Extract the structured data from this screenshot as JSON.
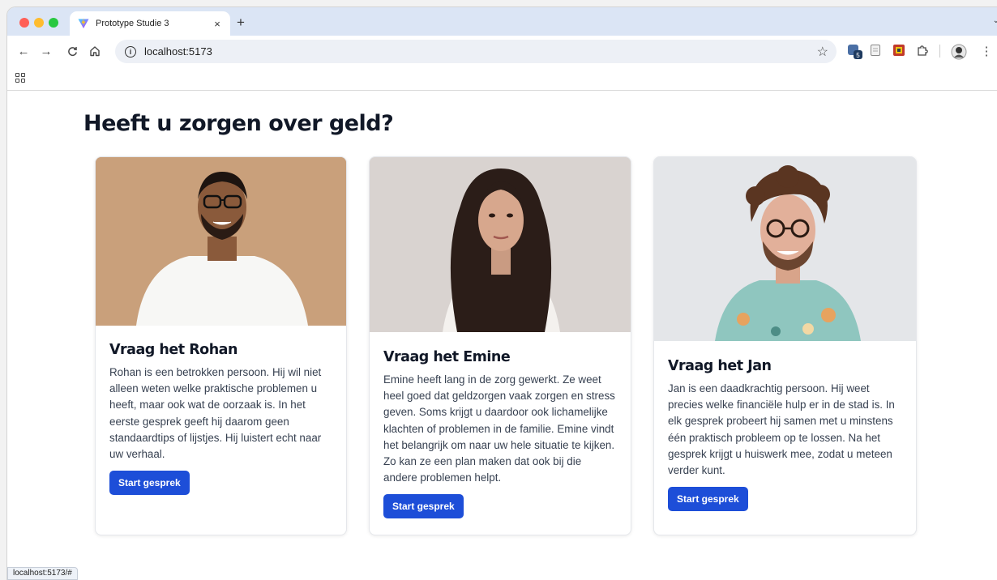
{
  "browser": {
    "tab_title": "Prototype Studie 3",
    "tab_close": "×",
    "new_tab": "+",
    "tab_menu": "⌄",
    "url": "localhost:5173",
    "back": "←",
    "forward": "→",
    "reload": "C",
    "extension_badge": "5",
    "status_url": "localhost:5173/#"
  },
  "page": {
    "heading": "Heeft u zorgen over geld?",
    "cards": [
      {
        "title": "Vraag het Rohan",
        "text": "Rohan is een betrokken persoon. Hij wil niet alleen weten welke praktische problemen u heeft, maar ook wat de oorzaak is. In het eerste gesprek geeft hij daarom geen standaardtips of lijstjes. Hij luistert echt naar uw verhaal.",
        "button": "Start gesprek"
      },
      {
        "title": "Vraag het Emine",
        "text": "Emine heeft lang in de zorg gewerkt. Ze weet heel goed dat geldzorgen vaak zorgen en stress geven. Soms krijgt u daardoor ook lichamelijke klachten of problemen in de familie. Emine vindt het belangrijk om naar uw hele situatie te kijken. Zo kan ze een plan maken dat ook bij die andere problemen helpt.",
        "button": "Start gesprek"
      },
      {
        "title": "Vraag het Jan",
        "text": "Jan is een daadkrachtig persoon. Hij weet precies welke financiële hulp er in de stad is. In elk gesprek probeert hij samen met u minstens één praktisch probleem op te lossen. Na het gesprek krijgt u huiswerk mee, zodat u meteen verder kunt.",
        "button": "Start gesprek"
      }
    ]
  },
  "colors": {
    "button": "#1d4ed8",
    "heading": "#111827",
    "tab_strip": "#dbe5f5"
  }
}
